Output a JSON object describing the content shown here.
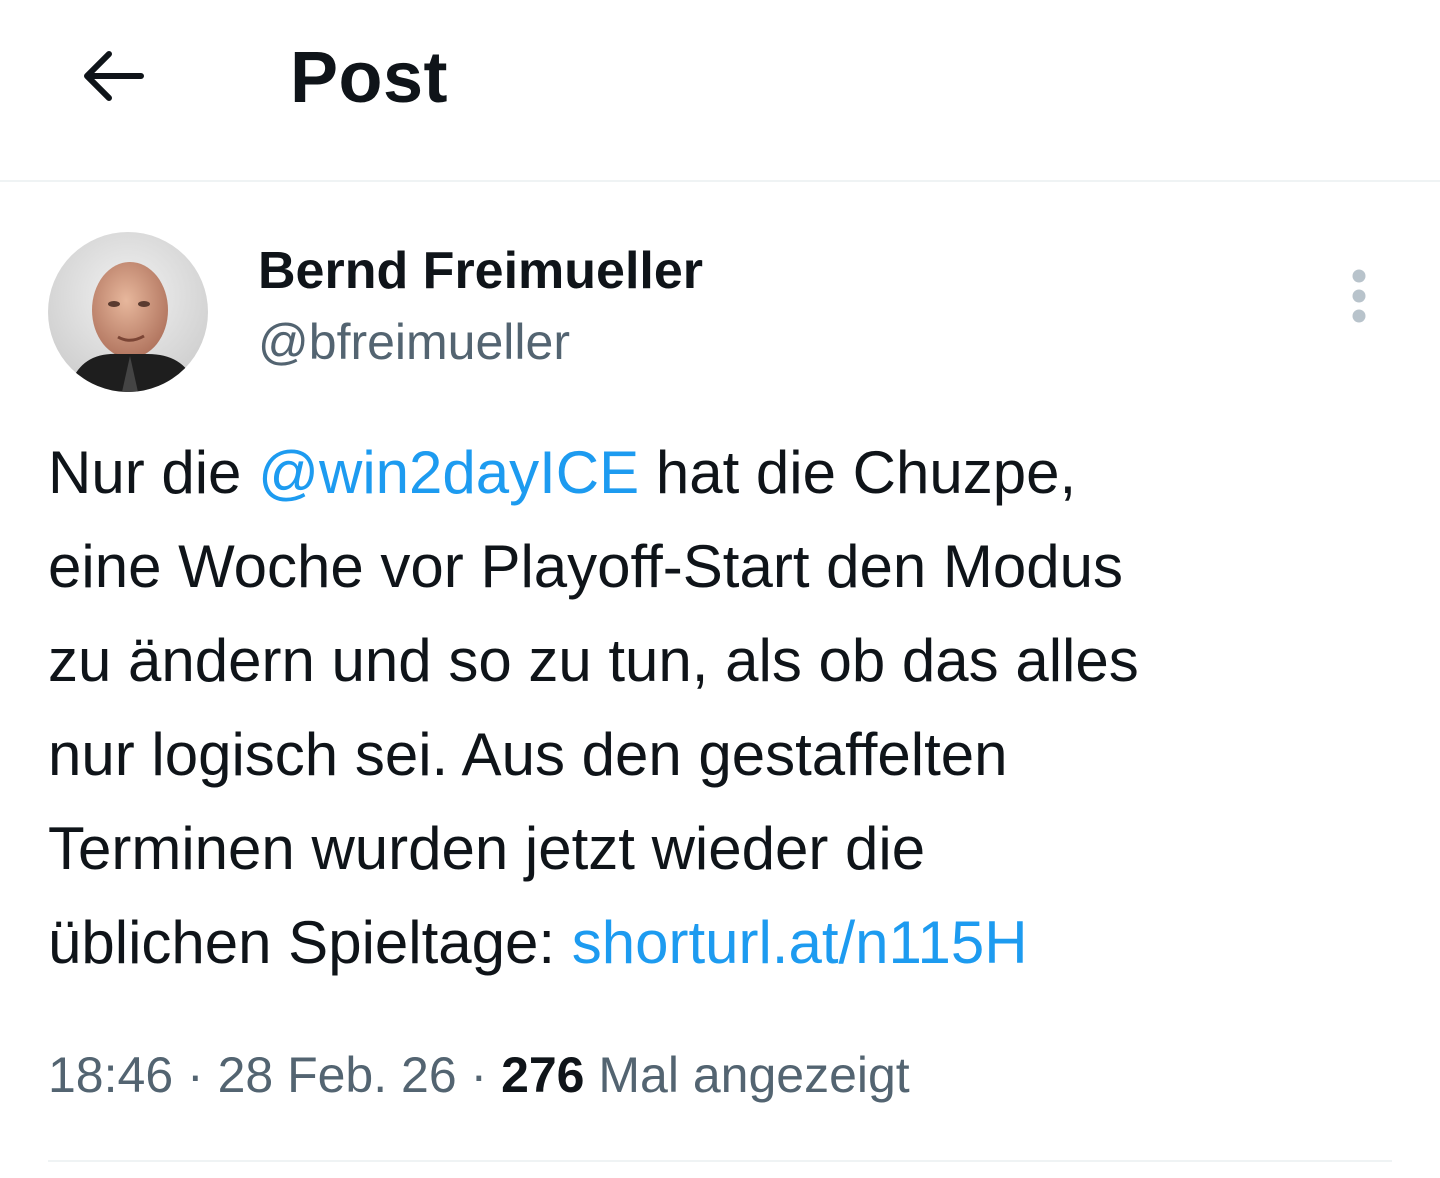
{
  "header": {
    "back_icon": "arrow-left-icon",
    "title": "Post"
  },
  "author": {
    "name": "Bernd Freimueller",
    "handle": "@bfreimueller",
    "more_icon": "more-vertical-icon"
  },
  "post": {
    "lines": [
      {
        "pre": "Nur die ",
        "mention": "@win2dayICE",
        "post": " hat die Chuzpe,"
      },
      {
        "text": "eine Woche vor Playoff-Start den Modus"
      },
      {
        "text": "zu ändern und so zu tun, als ob das alles"
      },
      {
        "text": "nur logisch sei. Aus den gestaffelten"
      },
      {
        "text": "Terminen wurden jetzt wieder die"
      },
      {
        "pre": "üblichen Spieltage: ",
        "link": "shorturl.at/n115H"
      }
    ]
  },
  "meta": {
    "time": "18:46",
    "sep1": " · ",
    "date": "28 Feb. 26",
    "sep2": " · ",
    "views": "276",
    "views_label": " Mal angezeigt"
  },
  "colors": {
    "text": "#0f1419",
    "secondary": "#536471",
    "link": "#1d9bf0",
    "divider": "#eff3f4"
  }
}
